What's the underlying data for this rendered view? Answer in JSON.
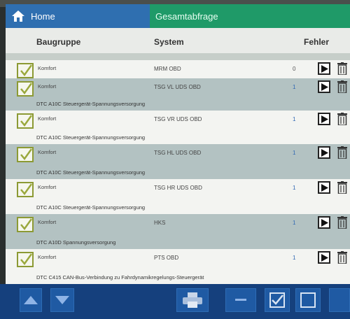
{
  "header": {
    "home_label": "Home",
    "title": "Gesamtabfrage"
  },
  "columns": {
    "baugruppe": "Baugruppe",
    "system": "System",
    "fehler": "Fehler"
  },
  "rows": [
    {
      "baugruppe": "Komfort",
      "system": "MRM OBD",
      "count": "0",
      "description": ""
    },
    {
      "baugruppe": "Komfort",
      "system": "TSG VL UDS OBD",
      "count": "1",
      "description": "DTC A10C Steuergerät-Spannungsversorgung"
    },
    {
      "baugruppe": "Komfort",
      "system": "TSG VR UDS OBD",
      "count": "1",
      "description": "DTC A10C Steuergerät-Spannungsversorgung"
    },
    {
      "baugruppe": "Komfort",
      "system": "TSG HL UDS OBD",
      "count": "1",
      "description": "DTC A10C Steuergerät-Spannungsversorgung"
    },
    {
      "baugruppe": "Komfort",
      "system": "TSG HR UDS OBD",
      "count": "1",
      "description": "DTC A10C Steuergerät-Spannungsversorgung"
    },
    {
      "baugruppe": "Komfort",
      "system": "HKS",
      "count": "1",
      "description": "DTC A10D Spannungsversorgung"
    },
    {
      "baugruppe": "Komfort",
      "system": "PTS OBD",
      "count": "1",
      "description": "DTC C415 CAN-Bus-Verbindung zu Fahrdynamikregelungs-Steuergerät"
    }
  ],
  "icons": {
    "home": "home-icon",
    "check": "checkmark-icon",
    "play": "play-icon",
    "trash": "trash-icon",
    "up": "arrow-up-icon",
    "down": "arrow-down-icon",
    "print": "printer-icon",
    "minus": "minus-icon",
    "checkbox": "checkbox-checked-icon",
    "square": "checkbox-empty-icon"
  },
  "colors": {
    "home_tab": "#2f6fb0",
    "title_tab": "#1f9a68",
    "row_dark": "#b3c2c2",
    "row_light": "#f3f4f1",
    "checkbox_border": "#8c9a34",
    "count": "#2f67b3",
    "toolbar": "#15407d"
  }
}
